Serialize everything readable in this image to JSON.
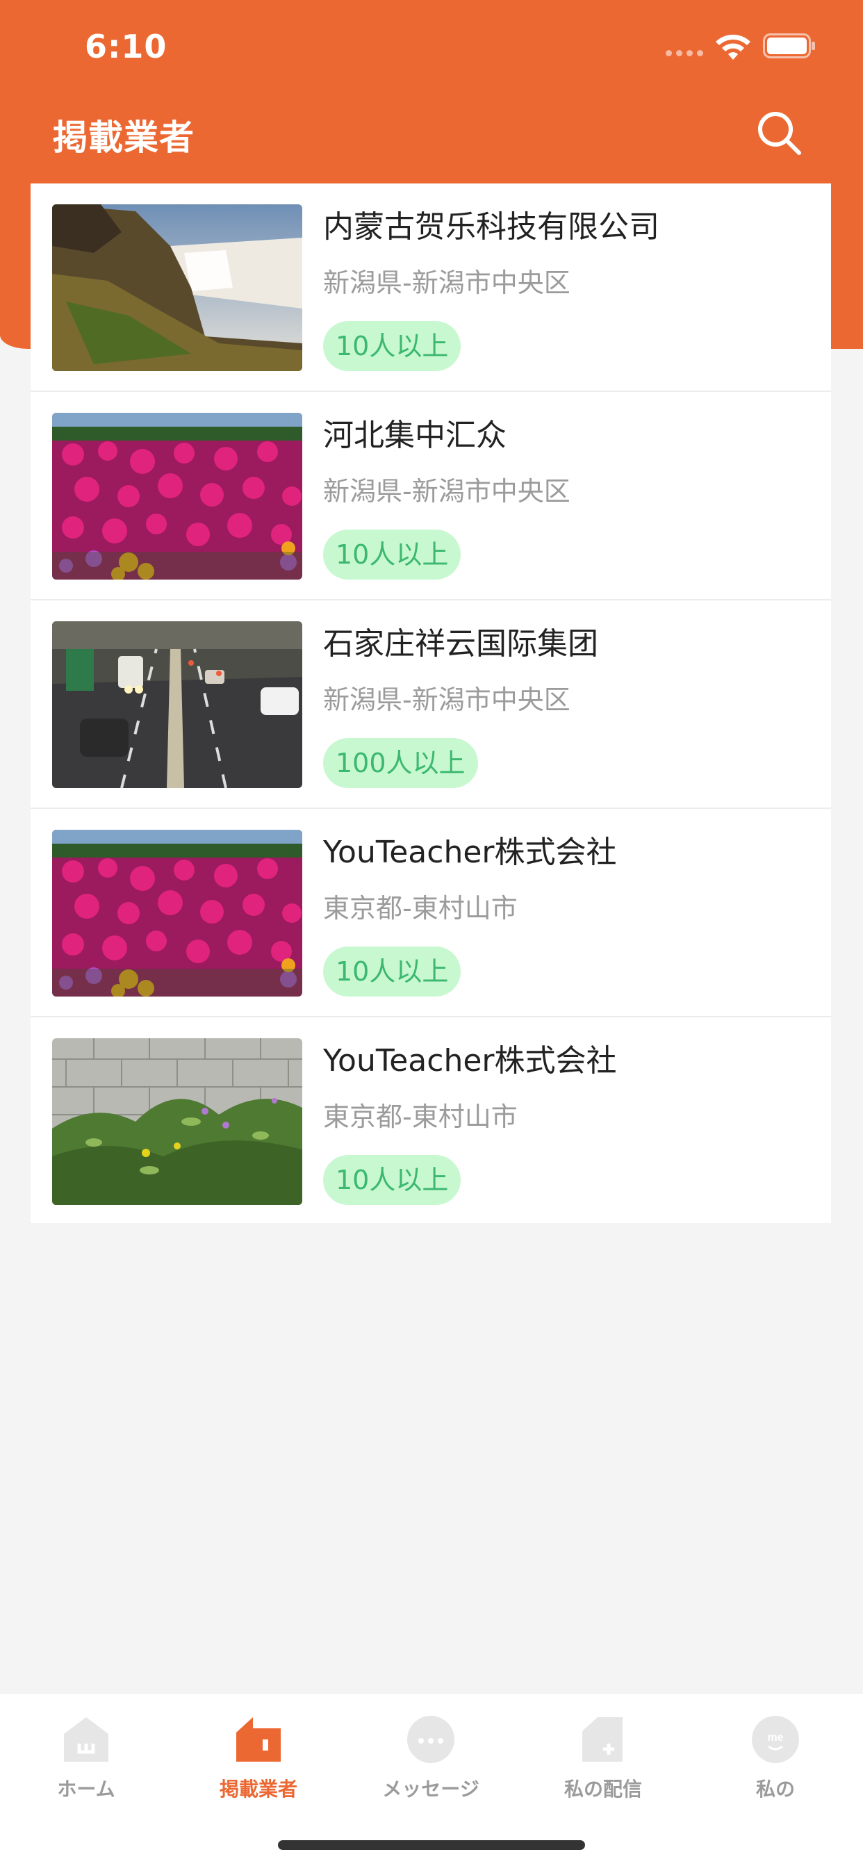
{
  "status_bar": {
    "time": "6:10"
  },
  "nav": {
    "title": "掲載業者"
  },
  "companies": [
    {
      "name": "内蒙古贺乐科技有限公司",
      "location": "新潟県-新潟市中央区",
      "size": "10人以上",
      "image": "waterfall"
    },
    {
      "name": "河北集中汇众",
      "location": "新潟県-新潟市中央区",
      "size": "10人以上",
      "image": "flowers"
    },
    {
      "name": "石家庄祥云国际集团",
      "location": "新潟県-新潟市中央区",
      "size": "100人以上",
      "image": "highway"
    },
    {
      "name": "YouTeacher株式会社",
      "location": "東京都-東村山市",
      "size": "10人以上",
      "image": "flowers"
    },
    {
      "name": "YouTeacher株式会社",
      "location": "東京都-東村山市",
      "size": "10人以上",
      "image": "wall-plants"
    }
  ],
  "tabs": [
    {
      "label": "ホーム",
      "icon": "home-icon",
      "active": false
    },
    {
      "label": "掲載業者",
      "icon": "company-icon",
      "active": true
    },
    {
      "label": "メッセージ",
      "icon": "message-icon",
      "active": false
    },
    {
      "label": "私の配信",
      "icon": "post-icon",
      "active": false
    },
    {
      "label": "私の",
      "icon": "me-icon",
      "active": false
    }
  ],
  "colors": {
    "accent": "#ec6832",
    "badge_bg": "#c8f8d0",
    "badge_text": "#3cb870",
    "inactive_tab": "#9b9b9b"
  }
}
